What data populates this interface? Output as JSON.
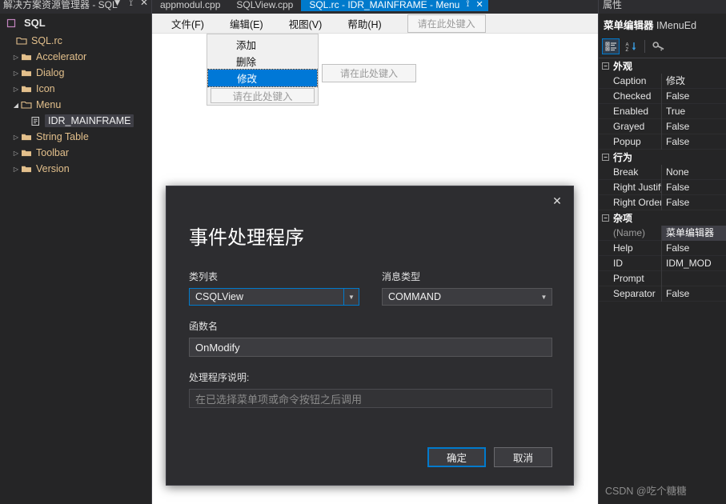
{
  "solution_explorer": {
    "panel_title": "解决方案资源管理器 - SQL",
    "title_icons": [
      "chevron-down-icon",
      "pin-icon",
      "close-icon"
    ],
    "root_label": "SQL",
    "tree": [
      {
        "label": "SQL.rc",
        "level": 0,
        "arrow": "",
        "icon": "rc-file-icon",
        "selected": false
      },
      {
        "label": "Accelerator",
        "level": 1,
        "arrow": "▷",
        "icon": "folder-icon",
        "selected": false
      },
      {
        "label": "Dialog",
        "level": 1,
        "arrow": "▷",
        "icon": "folder-icon",
        "selected": false
      },
      {
        "label": "Icon",
        "level": 1,
        "arrow": "▷",
        "icon": "folder-icon",
        "selected": false
      },
      {
        "label": "Menu",
        "level": 1,
        "arrow": "◢",
        "icon": "folder-open-icon",
        "selected": false
      },
      {
        "label": "IDR_MAINFRAME",
        "level": 2,
        "arrow": "",
        "icon": "menu-resource-icon",
        "selected": true
      },
      {
        "label": "String Table",
        "level": 1,
        "arrow": "▷",
        "icon": "folder-icon",
        "selected": false
      },
      {
        "label": "Toolbar",
        "level": 1,
        "arrow": "▷",
        "icon": "folder-icon",
        "selected": false
      },
      {
        "label": "Version",
        "level": 1,
        "arrow": "▷",
        "icon": "folder-icon",
        "selected": false
      }
    ]
  },
  "editor": {
    "tabs": [
      {
        "label": "appmodul.cpp",
        "active": false
      },
      {
        "label": "SQLView.cpp",
        "active": false
      },
      {
        "label": "SQL.rc - IDR_MAINFRAME - Menu",
        "active": true
      }
    ],
    "tab_pin_icon": "pin-icon",
    "tab_close_icon": "close-icon",
    "menubar": [
      {
        "label": "文件(F)",
        "accel": "F"
      },
      {
        "label": "编辑(E)",
        "accel": "E"
      },
      {
        "label": "视图(V)",
        "accel": "V"
      },
      {
        "label": "帮助(H)",
        "accel": "H"
      }
    ],
    "menubar_placeholder": "请在此处键入",
    "dropdown": {
      "items": [
        {
          "label": "添加",
          "selected": false,
          "placeholder": false
        },
        {
          "label": "删除",
          "selected": false,
          "placeholder": false
        },
        {
          "label": "修改",
          "selected": true,
          "placeholder": false
        },
        {
          "label": "请在此处键入",
          "selected": false,
          "placeholder": true
        }
      ],
      "sibling_placeholder": "请在此处键入"
    }
  },
  "dialog": {
    "title": "事件处理程序",
    "close_icon": "close-icon",
    "class_list_label": "类列表",
    "class_list_value": "CSQLView",
    "message_type_label": "消息类型",
    "message_type_value": "COMMAND",
    "function_name_label": "函数名",
    "function_name_value": "OnModify",
    "handler_desc_label": "处理程序说明:",
    "handler_desc_value": "在已选择菜单项或命令按钮之后调用",
    "ok_label": "确定",
    "cancel_label": "取消"
  },
  "properties": {
    "panel_title": "属性",
    "object_name": "菜单编辑器",
    "object_type": "IMenuEd",
    "toolbar": [
      {
        "icon": "categorized-icon",
        "active": true
      },
      {
        "icon": "alphabetical-sort-icon",
        "active": false
      },
      {
        "icon": "property-pages-key-icon",
        "active": false
      }
    ],
    "categories": [
      {
        "name": "外观",
        "rows": [
          {
            "name": "Caption",
            "value": "修改",
            "dim": false,
            "highlight": false
          },
          {
            "name": "Checked",
            "value": "False",
            "dim": false,
            "highlight": false
          },
          {
            "name": "Enabled",
            "value": "True",
            "dim": false,
            "highlight": false
          },
          {
            "name": "Grayed",
            "value": "False",
            "dim": false,
            "highlight": false
          },
          {
            "name": "Popup",
            "value": "False",
            "dim": false,
            "highlight": false
          }
        ]
      },
      {
        "name": "行为",
        "rows": [
          {
            "name": "Break",
            "value": "None",
            "dim": false,
            "highlight": false
          },
          {
            "name": "Right Justify",
            "value": "False",
            "dim": false,
            "highlight": false
          },
          {
            "name": "Right Order",
            "value": "False",
            "dim": false,
            "highlight": false
          }
        ]
      },
      {
        "name": "杂项",
        "rows": [
          {
            "name": "(Name)",
            "value": "菜单编辑器",
            "dim": true,
            "highlight": true
          },
          {
            "name": "Help",
            "value": "False",
            "dim": false,
            "highlight": false
          },
          {
            "name": "ID",
            "value": "IDM_MOD",
            "dim": false,
            "highlight": false
          },
          {
            "name": "Prompt",
            "value": "",
            "dim": false,
            "highlight": false
          },
          {
            "name": "Separator",
            "value": "False",
            "dim": false,
            "highlight": false
          }
        ]
      }
    ],
    "watermark": "CSDN @吃个糖糖"
  },
  "colors": {
    "accent": "#007acc",
    "menu_select": "#0078d7",
    "folder": "#e3c08c",
    "panel_bg": "#252526",
    "dialog_bg": "#2d2d30"
  }
}
